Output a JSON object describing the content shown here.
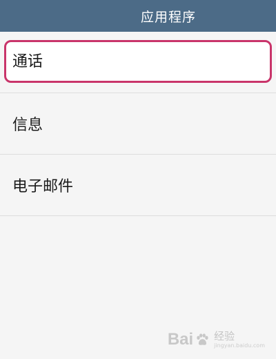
{
  "header": {
    "title": "应用程序"
  },
  "list": {
    "items": [
      {
        "label": "通话",
        "highlighted": true
      },
      {
        "label": "信息",
        "highlighted": false
      },
      {
        "label": "电子邮件",
        "highlighted": false
      }
    ]
  },
  "colors": {
    "header_bg": "#4c6b87",
    "highlight_border": "#c9346a",
    "background": "#f5f5f5"
  },
  "watermark": {
    "brand_left": "Bai",
    "brand_right": "",
    "subtitle": "经验",
    "url": "jingyan.baidu.com",
    "icon": "paw-icon"
  }
}
